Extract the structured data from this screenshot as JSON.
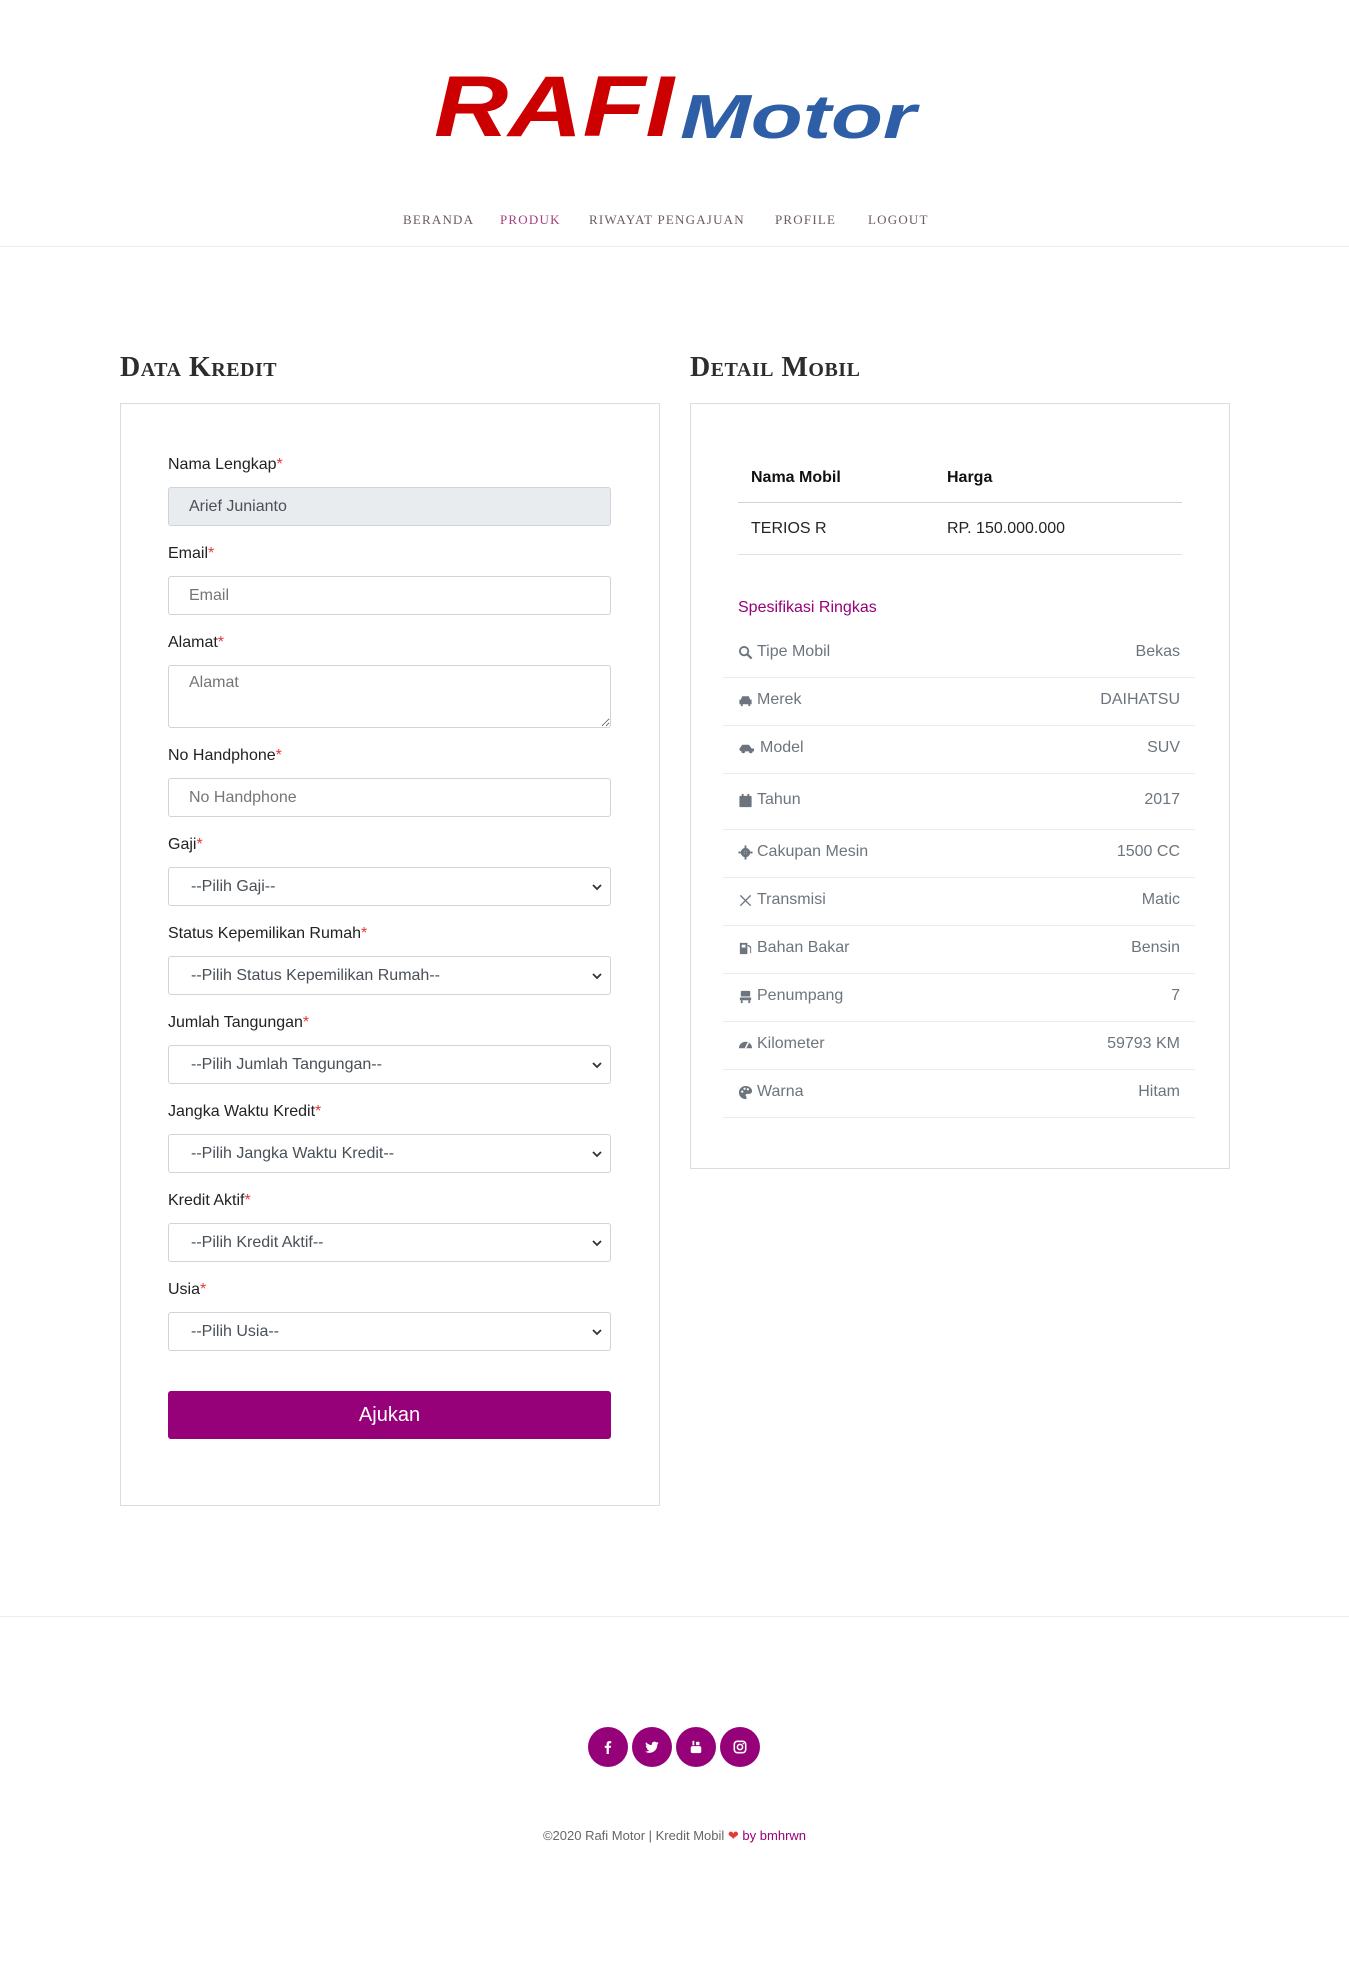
{
  "brand": {
    "name_red": "RAFI",
    "name_blue": "Motor",
    "red_color": "#cc0000",
    "blue_color": "#2e5ea6"
  },
  "nav": {
    "items": [
      {
        "label": "BERANDA",
        "active": false
      },
      {
        "label": "PRODUK",
        "active": true
      },
      {
        "label": "RIWAYAT PENGAJUAN",
        "active": false
      },
      {
        "label": "PROFILE",
        "active": false
      },
      {
        "label": "LOGOUT",
        "active": false
      }
    ]
  },
  "form": {
    "title": "Data Kredit",
    "required_mark": "*",
    "fields": {
      "nama": {
        "label": "Nama Lengkap",
        "value": "Arief Junianto"
      },
      "email": {
        "label": "Email",
        "placeholder": "Email"
      },
      "alamat": {
        "label": "Alamat",
        "placeholder": "Alamat"
      },
      "hp": {
        "label": "No Handphone",
        "placeholder": "No Handphone"
      },
      "gaji": {
        "label": "Gaji",
        "selected": "--Pilih Gaji--"
      },
      "status_rumah": {
        "label": "Status Kepemilikan Rumah",
        "selected": "--Pilih Status Kepemilikan Rumah--"
      },
      "tanggungan": {
        "label": "Jumlah Tangungan",
        "selected": "--Pilih Jumlah Tangungan--"
      },
      "jangka": {
        "label": "Jangka Waktu Kredit",
        "selected": "--Pilih Jangka Waktu Kredit--"
      },
      "kredit_aktif": {
        "label": "Kredit Aktif",
        "selected": "--Pilih Kredit Aktif--"
      },
      "usia": {
        "label": "Usia",
        "selected": "--Pilih Usia--"
      }
    },
    "submit_label": "Ajukan",
    "accent_color": "#960078"
  },
  "detail": {
    "title": "Detail Mobil",
    "table": {
      "headers": [
        "Nama Mobil",
        "Harga"
      ],
      "row": [
        "TERIOS R",
        "RP. 150.000.000"
      ]
    },
    "spec_heading": "Spesifikasi Ringkas",
    "specs": [
      {
        "icon": "search-icon",
        "label": "Tipe Mobil",
        "value": "Bekas"
      },
      {
        "icon": "car-icon",
        "label": "Merek",
        "value": "DAIHATSU"
      },
      {
        "icon": "car-side-icon",
        "label": "Model",
        "value": "SUV"
      },
      {
        "icon": "calendar-icon",
        "label": "Tahun",
        "value": "2017"
      },
      {
        "icon": "gear-icon",
        "label": "Cakupan Mesin",
        "value": "1500 CC"
      },
      {
        "icon": "tools-icon",
        "label": "Transmisi",
        "value": "Matic"
      },
      {
        "icon": "gas-pump-icon",
        "label": "Bahan Bakar",
        "value": "Bensin"
      },
      {
        "icon": "seat-icon",
        "label": "Penumpang",
        "value": "7"
      },
      {
        "icon": "speedometer-icon",
        "label": "Kilometer",
        "value": "59793 KM"
      },
      {
        "icon": "palette-icon",
        "label": "Warna",
        "value": "Hitam"
      }
    ]
  },
  "footer": {
    "social": [
      "facebook-icon",
      "twitter-icon",
      "youtube-icon",
      "instagram-icon"
    ],
    "copyright_text": "©2020 Rafi Motor | Kredit Mobil",
    "heart": "❤",
    "by_text": "by",
    "author": "bmhrwn"
  }
}
